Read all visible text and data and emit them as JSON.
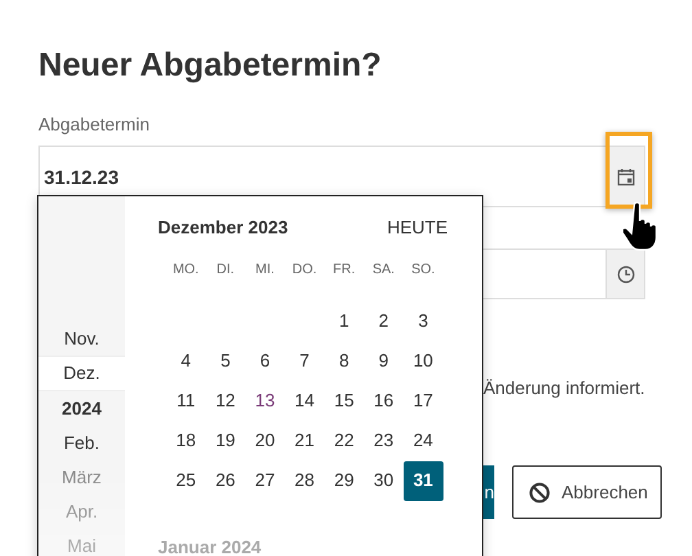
{
  "title": "Neuer Abgabetermin?",
  "date_field": {
    "label": "Abgabetermin",
    "value": "31.12.23"
  },
  "info_text": "Änderung informiert.",
  "buttons": [
    {
      "label": "n",
      "kind": "primary"
    },
    {
      "label": "Abbrechen",
      "kind": "cancel"
    }
  ],
  "datepicker": {
    "header": "Dezember 2023",
    "today_button": "HEUTE",
    "months": [
      {
        "label": "Nov.",
        "kind": "month",
        "selected": false,
        "dimmed": false
      },
      {
        "label": "Dez.",
        "kind": "month",
        "selected": true,
        "dimmed": false
      },
      {
        "label": "2024",
        "kind": "year",
        "selected": false,
        "dimmed": false
      },
      {
        "label": "Feb.",
        "kind": "month",
        "selected": false,
        "dimmed": false
      },
      {
        "label": "März",
        "kind": "month",
        "selected": false,
        "dimmed": true
      },
      {
        "label": "Apr.",
        "kind": "month",
        "selected": false,
        "dimmed": true
      },
      {
        "label": "Mai",
        "kind": "month",
        "selected": false,
        "dimmed": true
      }
    ],
    "weekdays": [
      "MO.",
      "DI.",
      "MI.",
      "DO.",
      "FR.",
      "SA.",
      "SO."
    ],
    "weeks": [
      {
        "kind": "partial",
        "days": [
          {
            "label": "1",
            "selected": false,
            "today": false
          },
          {
            "label": "2",
            "selected": false,
            "today": false
          },
          {
            "label": "3",
            "selected": false,
            "today": false
          }
        ]
      },
      {
        "kind": "full",
        "days": [
          {
            "label": "4",
            "selected": false,
            "today": false
          },
          {
            "label": "5",
            "selected": false,
            "today": false
          },
          {
            "label": "6",
            "selected": false,
            "today": false
          },
          {
            "label": "7",
            "selected": false,
            "today": false
          },
          {
            "label": "8",
            "selected": false,
            "today": false
          },
          {
            "label": "9",
            "selected": false,
            "today": false
          },
          {
            "label": "10",
            "selected": false,
            "today": false
          }
        ]
      },
      {
        "kind": "full",
        "days": [
          {
            "label": "11",
            "selected": false,
            "today": false
          },
          {
            "label": "12",
            "selected": false,
            "today": false
          },
          {
            "label": "13",
            "selected": false,
            "today": true
          },
          {
            "label": "14",
            "selected": false,
            "today": false
          },
          {
            "label": "15",
            "selected": false,
            "today": false
          },
          {
            "label": "16",
            "selected": false,
            "today": false
          },
          {
            "label": "17",
            "selected": false,
            "today": false
          }
        ]
      },
      {
        "kind": "full",
        "days": [
          {
            "label": "18",
            "selected": false,
            "today": false
          },
          {
            "label": "19",
            "selected": false,
            "today": false
          },
          {
            "label": "20",
            "selected": false,
            "today": false
          },
          {
            "label": "21",
            "selected": false,
            "today": false
          },
          {
            "label": "22",
            "selected": false,
            "today": false
          },
          {
            "label": "23",
            "selected": false,
            "today": false
          },
          {
            "label": "24",
            "selected": false,
            "today": false
          }
        ]
      },
      {
        "kind": "full",
        "days": [
          {
            "label": "25",
            "selected": false,
            "today": false
          },
          {
            "label": "26",
            "selected": false,
            "today": false
          },
          {
            "label": "27",
            "selected": false,
            "today": false
          },
          {
            "label": "28",
            "selected": false,
            "today": false
          },
          {
            "label": "29",
            "selected": false,
            "today": false
          },
          {
            "label": "30",
            "selected": false,
            "today": false
          },
          {
            "label": "31",
            "selected": true,
            "today": false
          }
        ]
      }
    ],
    "next_month": "Januar 2024"
  }
}
